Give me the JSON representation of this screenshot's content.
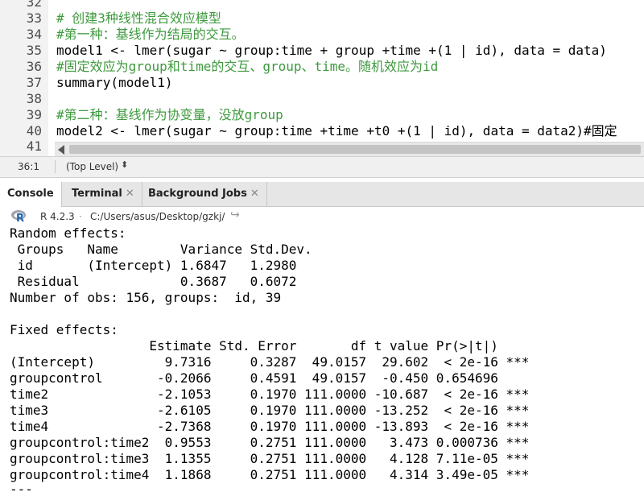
{
  "editor": {
    "lines": [
      {
        "n": "32",
        "code": ""
      },
      {
        "n": "33",
        "code": "# 创建3种线性混合效应模型",
        "kind": "comment"
      },
      {
        "n": "34",
        "code": "#第一种：基线作为结局的交互。",
        "kind": "comment"
      },
      {
        "n": "35",
        "code": "model1 <- lmer(sugar ~ group:time + group +time +(1 | id), data = data)",
        "kind": "code"
      },
      {
        "n": "36",
        "code": "#固定效应为group和time的交互、group、time。随机效应为id",
        "kind": "comment"
      },
      {
        "n": "37",
        "code": "summary(model1)",
        "kind": "code"
      },
      {
        "n": "38",
        "code": ""
      },
      {
        "n": "39",
        "code": "#第二种：基线作为协变量，没放group",
        "kind": "comment"
      },
      {
        "n": "40",
        "code": "model2 <- lmer(sugar ~ group:time +time +t0 +(1 | id), data = data2)#固定",
        "kind": "code"
      },
      {
        "n": "41",
        "code": ""
      }
    ]
  },
  "status": {
    "cursor": "36:1",
    "scope": "(Top Level)",
    "scope_arrow": "⬍"
  },
  "tabs": [
    {
      "label": "Console",
      "active": true,
      "closable": false
    },
    {
      "label": "Terminal",
      "active": false,
      "closable": true
    },
    {
      "label": "Background Jobs",
      "active": false,
      "closable": true
    }
  ],
  "console_header": {
    "r_version": "R 4.2.3",
    "separator": "·",
    "path": "C:/Users/asus/Desktop/gzkj/"
  },
  "console_output": [
    "Random effects:",
    " Groups   Name        Variance Std.Dev.",
    " id       (Intercept) 1.6847   1.2980  ",
    " Residual             0.3687   0.6072  ",
    "Number of obs: 156, groups:  id, 39",
    "",
    "Fixed effects:",
    "                  Estimate Std. Error       df t value Pr(>|t|)    ",
    "(Intercept)         9.7316     0.3287  49.0157  29.602  < 2e-16 ***",
    "groupcontrol       -0.2066     0.4591  49.0157  -0.450 0.654696    ",
    "time2              -2.1053     0.1970 111.0000 -10.687  < 2e-16 ***",
    "time3              -2.6105     0.1970 111.0000 -13.252  < 2e-16 ***",
    "time4              -2.7368     0.1970 111.0000 -13.893  < 2e-16 ***",
    "groupcontrol:time2  0.9553     0.2751 111.0000   3.473 0.000736 ***",
    "groupcontrol:time3  1.1355     0.2751 111.0000   4.128 7.11e-05 ***",
    "groupcontrol:time4  1.1868     0.2751 111.0000   4.314 3.49e-05 ***",
    "---"
  ],
  "colors": {
    "comment": "#3e9a3e",
    "number": "#0000ff",
    "r_logo": "#2165b6"
  }
}
